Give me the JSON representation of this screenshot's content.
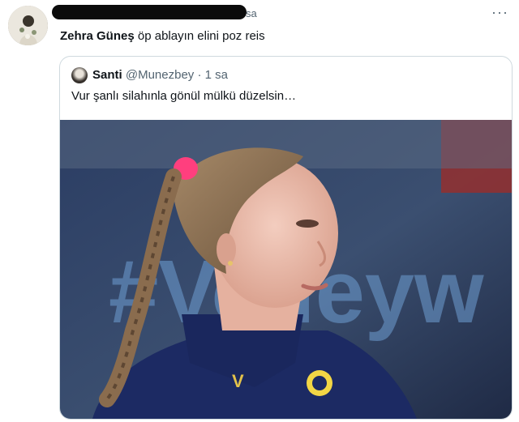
{
  "tweet": {
    "time": "sa",
    "reply_name": "Zehra Güneş",
    "reply_text": "öp ablayın elini poz reis",
    "more_icon": "more-icon"
  },
  "quote": {
    "name": "Santi",
    "handle": "@Munezbey",
    "separator": "·",
    "time": "1 sa",
    "text": "Vur şanlı silahınla gönül mülkü düzelsin…",
    "media_caption": "#Volleyw"
  },
  "colors": {
    "muted": "#536471",
    "border": "#cfd9de",
    "jersey": "#1c2a63",
    "scrunchie": "#ff3f7e"
  }
}
